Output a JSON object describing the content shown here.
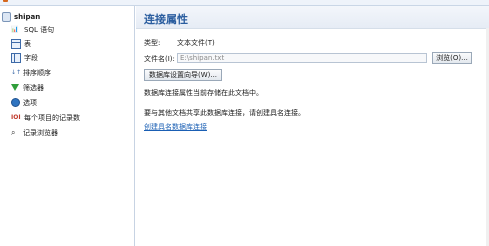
{
  "window": {
    "title": ""
  },
  "sidebar": {
    "root": {
      "label": "shipan",
      "icon": "database-icon"
    },
    "items": [
      {
        "label": "SQL 语句",
        "icon": "sql-icon"
      },
      {
        "label": "表",
        "icon": "table-icon"
      },
      {
        "label": "字段",
        "icon": "field-icon"
      },
      {
        "label": "排序顺序",
        "icon": "sort-icon"
      },
      {
        "label": "筛选器",
        "icon": "filter-icon"
      },
      {
        "label": "选项",
        "icon": "option-icon"
      },
      {
        "label": "每个项目的记录数",
        "icon": "top-records-icon"
      },
      {
        "label": "记录浏览器",
        "icon": "browse-icon"
      }
    ]
  },
  "main": {
    "title": "连接属性",
    "type_label": "类型:",
    "type_value": "文本文件(T)",
    "filename_label": "文件名(I):",
    "filename_value": "E:\\shipan.txt",
    "browse_button": "浏览(O)...",
    "wizard_button": "数据库设置向导(W)...",
    "info_line_1": "数据库连接属性当前存储在此文档中。",
    "info_line_2": "要与其他文档共享此数据库连接，请创建具名连接。",
    "create_link": "创建具名数据库连接"
  }
}
